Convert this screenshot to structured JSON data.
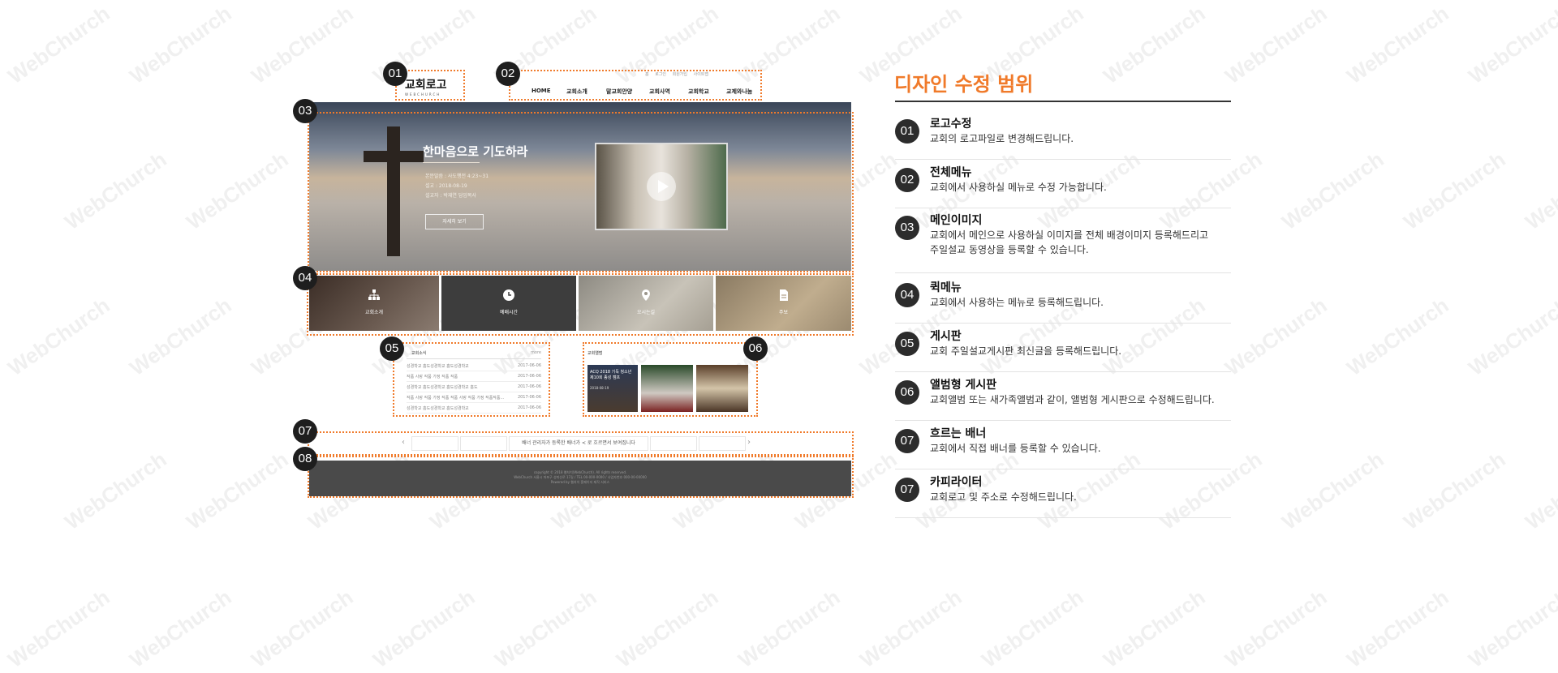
{
  "watermark": "WebChurch",
  "brand_color": "#f07a2a",
  "mockup": {
    "logo": {
      "text": "교회로고",
      "sub": "WEBCHURCH"
    },
    "topnav": {
      "util_links": [
        "홈",
        "로그인",
        "회원가입",
        "사이트맵"
      ],
      "items": [
        "HOME",
        "교회소개",
        "말교회안양",
        "교회사역",
        "교회학교",
        "교제와나눔"
      ]
    },
    "hero": {
      "title": "한마음으로 기도하라",
      "lines": [
        "본문말씀 : 사도행전 4:23~31",
        "설교 : 2018-08-19",
        "설교자 : 박재연 담임목사"
      ],
      "button": "자세히 보기"
    },
    "quick_menu": [
      {
        "label": "교회소개",
        "icon": "sitemap-icon"
      },
      {
        "label": "예배시간",
        "icon": "clock-icon"
      },
      {
        "label": "오시는길",
        "icon": "map-pin-icon"
      },
      {
        "label": "주보",
        "icon": "document-icon"
      }
    ],
    "board": {
      "title": "교회소식",
      "more": "more",
      "rows": [
        {
          "title": "성경학교 홈도성경학교 홈도성경학교",
          "date": "2017-06-06"
        },
        {
          "title": "작품 사랑 작품 가정 작품 작품",
          "date": "2017-06-06"
        },
        {
          "title": "성경학교 홈도성경학교 홈도성경학교 홈도",
          "date": "2017-06-06"
        },
        {
          "title": "작품 사랑 작품 가정 작품 작품 사랑 작품 가정 작품작품...",
          "date": "2017-06-06"
        },
        {
          "title": "성경학교 홈도성경학교 홈도성경학교",
          "date": "2017-06-06"
        }
      ]
    },
    "album": {
      "title": "교회앨범",
      "caption": "ACQ 2018 기독 청소년 제10회 종성 캠프",
      "date": "2018-08-19"
    },
    "banner": {
      "text": "배너 관리자가 등록한 배너가 < 로 흐르면서 보여집니다",
      "prev": "‹",
      "next": "›"
    },
    "footer": {
      "lines": [
        "copyright © 2018 웹처치(WebChurch). All rights reserved.",
        "WebChurch 서울시 마포구 성미산로 17길 / TEL 00-000-0000 / 사업자번호 000-00-00000",
        "Powered by 웹처치 홈페이지 제작 서비스"
      ]
    }
  },
  "badges": [
    "01",
    "02",
    "03",
    "04",
    "05",
    "06",
    "07",
    "08"
  ],
  "panel": {
    "title": "디자인 수정 범위",
    "items": [
      {
        "num": "01",
        "title": "로고수정",
        "desc": [
          "교회의 로고파일로 변경해드립니다."
        ]
      },
      {
        "num": "02",
        "title": "전체메뉴",
        "desc": [
          "교회에서 사용하실 메뉴로 수정 가능합니다."
        ]
      },
      {
        "num": "03",
        "title": "메인이미지",
        "desc": [
          "교회에서 메인으로 사용하실 이미지를 전체 배경이미지 등록해드리고",
          "주일설교 동영상을 등록할 수 있습니다."
        ]
      },
      {
        "num": "04",
        "title": "퀵메뉴",
        "desc": [
          "교회에서 사용하는 메뉴로 등록해드립니다."
        ]
      },
      {
        "num": "05",
        "title": "게시판",
        "desc": [
          "교회 주일설교게시판 최신글을 등록해드립니다."
        ]
      },
      {
        "num": "06",
        "title": "앨범형 게시판",
        "desc": [
          "교회앨범 또는 새가족앨범과 같이, 앨범형 게시판으로 수정해드립니다."
        ]
      },
      {
        "num": "07",
        "title": "흐르는 배너",
        "desc": [
          "교회에서 직접 배너를 등록할 수 있습니다."
        ]
      },
      {
        "num": "07",
        "title": "카피라이터",
        "desc": [
          "교회로고 및 주소로 수정해드립니다."
        ]
      }
    ]
  }
}
